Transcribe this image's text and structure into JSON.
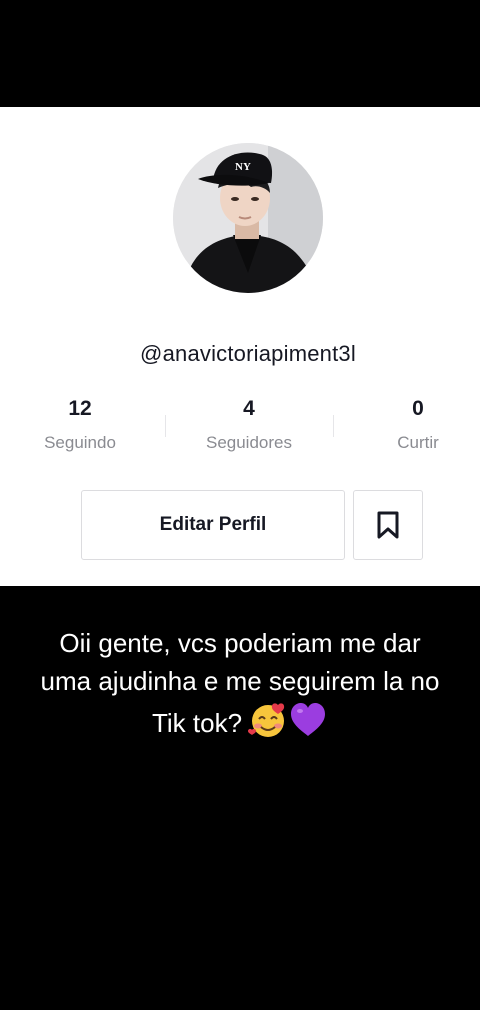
{
  "profile": {
    "username": "@anavictoriapiment3l",
    "avatar_icon": "user-avatar-photo"
  },
  "stats": {
    "following": {
      "value": "12",
      "label": "Seguindo"
    },
    "followers": {
      "value": "4",
      "label": "Seguidores"
    },
    "likes": {
      "value": "0",
      "label": "Curtir"
    }
  },
  "actions": {
    "edit_profile_label": "Editar Perfil",
    "bookmark_icon": "bookmark-icon"
  },
  "caption": {
    "line1": "Oii gente, vcs poderiam me dar",
    "line2": "uma ajudinha e me seguirem la no",
    "line3": "Tik tok?",
    "emojis": [
      "smiling-face-with-hearts",
      "purple-heart"
    ]
  },
  "colors": {
    "background": "#000000",
    "card": "#ffffff",
    "text_primary": "#161823",
    "text_secondary": "#8a8b91",
    "border": "#dcdcdf",
    "heart": "#9b3de0"
  }
}
